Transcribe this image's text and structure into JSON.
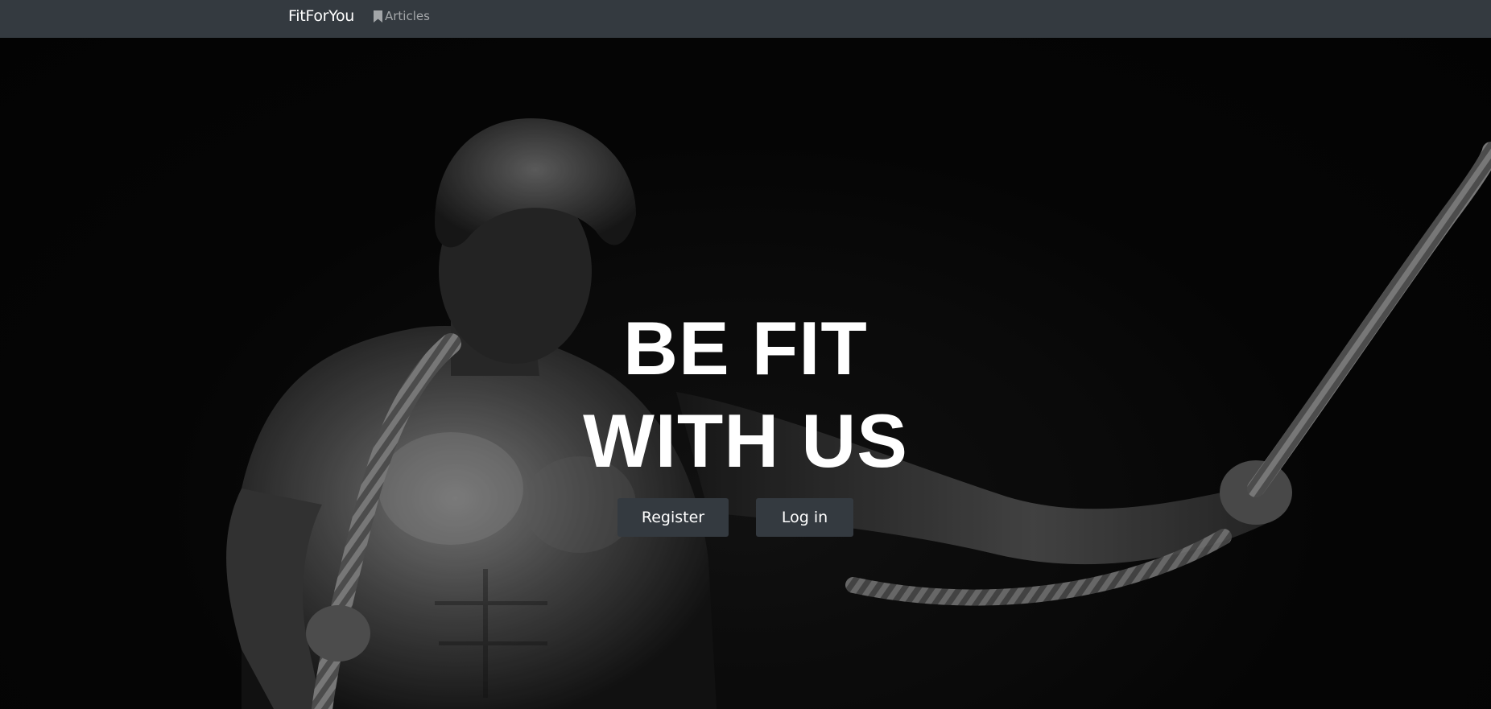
{
  "navbar": {
    "brand": "FitForYou",
    "links": [
      {
        "label": "Articles",
        "icon": "bookmark-icon"
      }
    ]
  },
  "hero": {
    "headline_line1": "BE FIT",
    "headline_line2": "WITH US",
    "image": "black-and-white photo of shirtless athlete holding battle rope",
    "buttons": {
      "register": "Register",
      "login": "Log in"
    }
  },
  "colors": {
    "navbar_bg": "#343a40",
    "button_bg": "#343a40",
    "text_primary": "#ffffff",
    "nav_link_muted": "rgba(255,255,255,0.55)"
  }
}
